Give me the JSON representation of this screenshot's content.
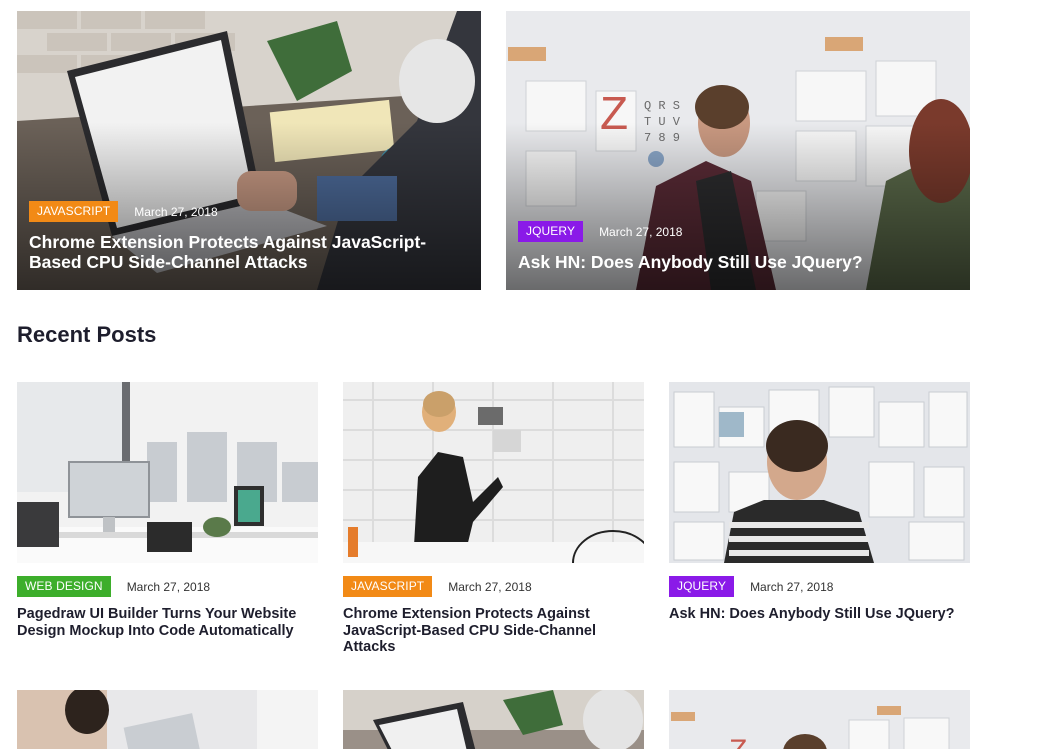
{
  "featured": [
    {
      "tag": "JAVASCRIPT",
      "date": "March 27, 2018",
      "title": "Chrome Extension Protects Against JavaScript-Based CPU Side-Channel Attacks"
    },
    {
      "tag": "JQUERY",
      "date": "March 27, 2018",
      "title": "Ask HN: Does Anybody Still Use JQuery?"
    }
  ],
  "recent": {
    "heading": "Recent Posts",
    "posts": [
      {
        "tag": "WEB DESIGN",
        "date": "March 27, 2018",
        "title": "Pagedraw UI Builder Turns Your Website Design Mockup Into Code Automatically"
      },
      {
        "tag": "JAVASCRIPT",
        "date": "March 27, 2018",
        "title": "Chrome Extension Protects Against JavaScript-Based CPU Side-Channel Attacks"
      },
      {
        "tag": "JQUERY",
        "date": "March 27, 2018",
        "title": "Ask HN: Does Anybody Still Use JQuery?"
      }
    ]
  },
  "colors": {
    "javascript": "#f28a16",
    "jquery": "#8a1ae8",
    "web_design": "#3dae2b",
    "heading_text": "#1e1e2d"
  }
}
